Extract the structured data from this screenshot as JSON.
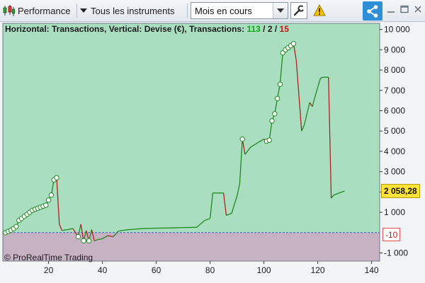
{
  "toolbar": {
    "performance_label": "Performance",
    "instruments_label": "Tous les instruments",
    "period_value": "Mois en cours",
    "icons": {
      "performance": "candlestick-icon",
      "wrench": "wrench-icon",
      "warning": "warning-icon",
      "share": "share-icon",
      "minimize": "minimize-icon",
      "maximize": "maximize-icon",
      "close": "close-icon"
    }
  },
  "chart": {
    "header_prefix": "Horizontal: Transactions, Vertical: Devise (€), Transactions: ",
    "transactions_total": "113",
    "transactions_sep1": " / ",
    "transactions_wins": "2",
    "transactions_sep2": " / ",
    "transactions_losses": "15",
    "watermark": "© ProRealTime Trading",
    "last_value": "2 058,28",
    "zero_line_value": "-10",
    "colors": {
      "positive_bg": "#a9dfc0",
      "negative_bg": "#c7b2c3",
      "up_line": "#1e8a1e",
      "down_line": "#b22020",
      "marker_fill": "#ffffff",
      "zero_line": "#3a5ad0"
    }
  },
  "chart_data": {
    "type": "line",
    "xlabel": "",
    "ylabel": "",
    "xlim": [
      3,
      143
    ],
    "ylim": [
      -1400,
      10300
    ],
    "x_ticks": [
      20,
      40,
      60,
      80,
      100,
      120,
      140
    ],
    "y_ticks": [
      -1000,
      1000,
      2000,
      3000,
      4000,
      5000,
      6000,
      7000,
      8000,
      9000,
      10000
    ],
    "y_tick_labels": [
      "-1 000",
      "1 000",
      "2 000",
      "3 000",
      "4 000",
      "5 000",
      "6 000",
      "7 000",
      "8 000",
      "9 000",
      "10 000"
    ],
    "series": [
      {
        "x": [
          4,
          5,
          6,
          7,
          8,
          9,
          10,
          11,
          12,
          13,
          14,
          15,
          16,
          17,
          18,
          19,
          20,
          21,
          22,
          23,
          24,
          25,
          27,
          29,
          31,
          32,
          33,
          34,
          35,
          36,
          37,
          38,
          40,
          42,
          44,
          46,
          48,
          50,
          55,
          60,
          65,
          70,
          75,
          78,
          80,
          81,
          82,
          85,
          86,
          88,
          90,
          91,
          92,
          93,
          95,
          98,
          100,
          101,
          102,
          103,
          104,
          105,
          106,
          107,
          108,
          109,
          110,
          111,
          112,
          114,
          115,
          117,
          118,
          119,
          121,
          122,
          124,
          125,
          126,
          128,
          130
        ],
        "y": [
          0,
          60,
          120,
          200,
          300,
          600,
          700,
          800,
          900,
          1000,
          1100,
          1150,
          1200,
          1250,
          1300,
          1350,
          1600,
          1850,
          2600,
          2700,
          400,
          100,
          150,
          200,
          -200,
          420,
          -400,
          100,
          -400,
          150,
          -400,
          -350,
          -300,
          -150,
          -200,
          80,
          120,
          150,
          200,
          220,
          230,
          250,
          260,
          600,
          700,
          1950,
          1950,
          1950,
          850,
          950,
          1800,
          2400,
          4600,
          3850,
          4200,
          4450,
          4600,
          4500,
          4550,
          5500,
          5850,
          6600,
          7300,
          8850,
          9000,
          9100,
          9200,
          9300,
          8500,
          5000,
          5300,
          6400,
          6200,
          6700,
          7600,
          7650,
          7650,
          1700,
          1850,
          1950,
          2050
        ],
        "markers": [
          1,
          1,
          1,
          1,
          1,
          1,
          1,
          1,
          1,
          1,
          1,
          1,
          1,
          1,
          1,
          1,
          1,
          1,
          1,
          1,
          0,
          0,
          0,
          0,
          1,
          0,
          1,
          0,
          1,
          0,
          0,
          0,
          0,
          0,
          0,
          0,
          0,
          0,
          0,
          0,
          0,
          0,
          0,
          0,
          0,
          0,
          0,
          0,
          0,
          0,
          0,
          0,
          1,
          0,
          0,
          0,
          0,
          1,
          1,
          1,
          1,
          1,
          1,
          1,
          1,
          1,
          1,
          1,
          0,
          0,
          0,
          0,
          0,
          0,
          0,
          0,
          0,
          0,
          0,
          0,
          0
        ]
      }
    ],
    "grid": false,
    "zero_line": 0
  }
}
